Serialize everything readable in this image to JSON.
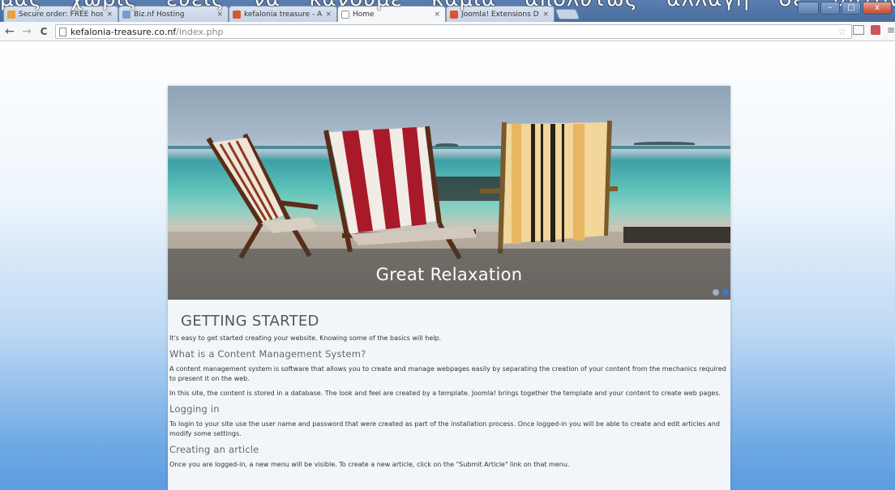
{
  "browser": {
    "overlay_text": "μας χωρίς ευείς να κάνουμε καμία απολύτως αλλαγή σε αυτόν",
    "tabs": [
      {
        "title": "Secure order: FREE hostin",
        "color": "#e8a236"
      },
      {
        "title": "Biz.nf Hosting",
        "color": "#7a9cc8"
      },
      {
        "title": "kefalonia treasure - Admi",
        "color": "#d9552f"
      },
      {
        "title": "Home",
        "color": "#ffffff"
      },
      {
        "title": "Joomla! Extensions Direct",
        "color": "#d9552f"
      }
    ],
    "tab_close": "×",
    "url_host": "kefalonia-treasure.co.nf",
    "url_path": "/index.php",
    "icons": {
      "back": "←",
      "forward": "→",
      "reload": "C",
      "star": "☆",
      "menu": "≡",
      "minimize": "–",
      "maximize": "□",
      "close": "x"
    }
  },
  "slider": {
    "caption": "Great Relaxation",
    "active_dot": 1
  },
  "article": {
    "heading": "GETTING STARTED",
    "intro": "It's easy to get started creating your website. Knowing some of the basics will help.",
    "sections": [
      {
        "title": "What is a Content Management System?",
        "paragraphs": [
          "A content management system is software that allows you to create and manage webpages easily by separating the creation of your content from the mechanics required to present it on the web.",
          "In this site, the content is stored in a database. The look and feel are created by a template. Joomla! brings together the template and your content to create web pages."
        ]
      },
      {
        "title": "Logging in",
        "paragraphs": [
          "To login to your site use the user name and password that were created as part of the installation process. Once logged-in you will be able to create and edit articles and modify some settings."
        ]
      },
      {
        "title": "Creating an article",
        "paragraphs": [
          "Once you are logged-in, a new menu will be visible. To create a new article, click on the \"Submit Article\" link on that menu."
        ]
      }
    ]
  }
}
